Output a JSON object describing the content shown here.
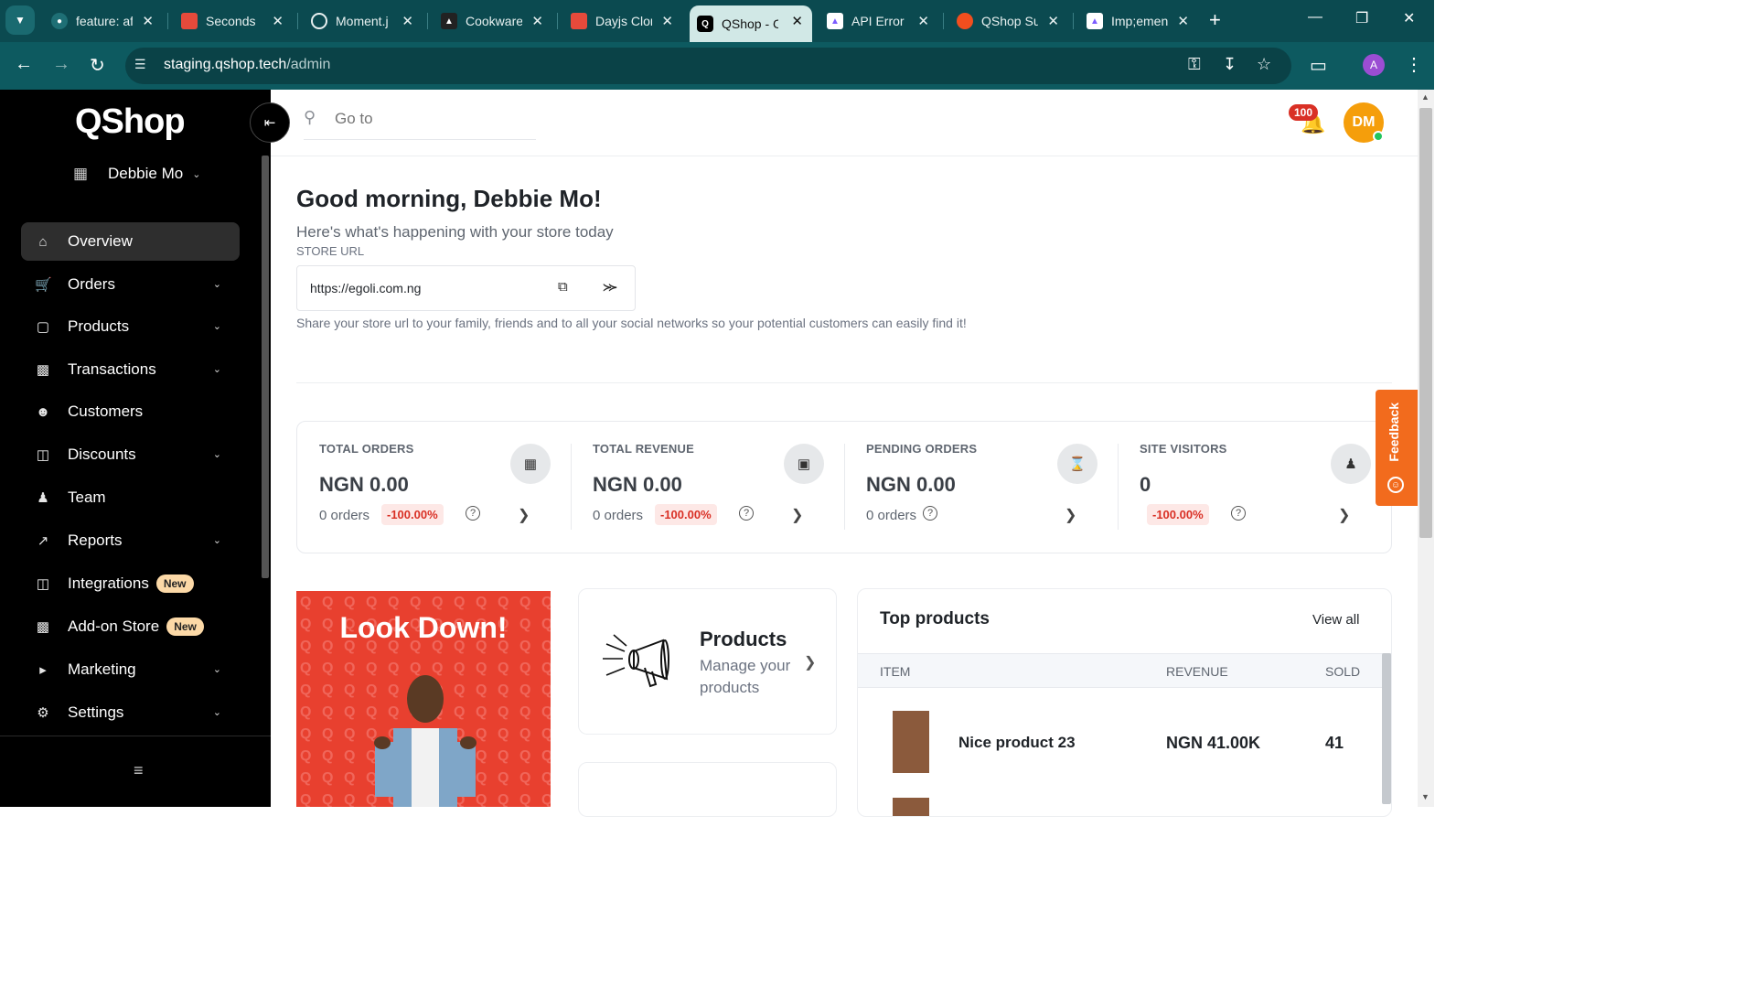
{
  "browser": {
    "tabs": [
      {
        "title": "feature: af",
        "favicon_color": "#1e6f75",
        "icon": "github-icon"
      },
      {
        "title": "Seconds",
        "favicon_color": "#e64a3b",
        "icon": "dayjs-icon"
      },
      {
        "title": "Moment.j",
        "favicon_color": "#1e6f75",
        "icon": "clock-icon"
      },
      {
        "title": "Cookware",
        "favicon_color": "#222222",
        "icon": "cookware-icon"
      },
      {
        "title": "Dayjs Clon",
        "favicon_color": "#e64a3b",
        "icon": "dayjs-icon"
      },
      {
        "title": "QShop - C",
        "favicon_color": "#000000",
        "icon": "qshop-icon",
        "active": true
      },
      {
        "title": "API Error",
        "favicon_color": "#ffffff",
        "icon": "clickup-icon"
      },
      {
        "title": "QShop Su",
        "favicon_color": "#f24e1e",
        "icon": "figma-icon"
      },
      {
        "title": "Imp;emen",
        "favicon_color": "#ffffff",
        "icon": "clickup-icon"
      }
    ],
    "url_host": "staging.qshop.tech",
    "url_path": "/admin",
    "profile_initial": "A"
  },
  "sidebar": {
    "logo": "QShop",
    "store_name": "Debbie Mo",
    "items": [
      {
        "label": "Overview",
        "icon": "home-icon",
        "active": true
      },
      {
        "label": "Orders",
        "icon": "cart-icon",
        "has_dropdown": true
      },
      {
        "label": "Products",
        "icon": "bag-icon",
        "has_dropdown": true
      },
      {
        "label": "Transactions",
        "icon": "cash-icon",
        "has_dropdown": true
      },
      {
        "label": "Customers",
        "icon": "customers-icon"
      },
      {
        "label": "Discounts",
        "icon": "gift-icon",
        "has_dropdown": true
      },
      {
        "label": "Team",
        "icon": "team-icon"
      },
      {
        "label": "Reports",
        "icon": "chart-icon",
        "has_dropdown": true
      },
      {
        "label": "Integrations",
        "icon": "integrations-icon",
        "badge": "New"
      },
      {
        "label": "Add-on Store",
        "icon": "puzzle-icon",
        "badge": "New"
      },
      {
        "label": "Marketing",
        "icon": "megaphone-icon",
        "has_dropdown": true
      },
      {
        "label": "Settings",
        "icon": "gear-icon",
        "has_dropdown": true
      }
    ]
  },
  "header": {
    "search_placeholder": "Go to",
    "notification_count": "100",
    "avatar_initials": "DM"
  },
  "main": {
    "greeting": "Good morning, Debbie Mo!",
    "subtitle": "Here's what's happening with your store today",
    "store_url_label": "STORE URL",
    "store_url": "https://egoli.com.ng",
    "share_note": "Share your store url to your family, friends and to all your social networks so your potential customers can easily find it!",
    "stats": [
      {
        "label": "TOTAL ORDERS",
        "value": "NGN 0.00",
        "orders": "0 orders",
        "change": "-100.00%",
        "icon": "store-icon"
      },
      {
        "label": "TOTAL REVENUE",
        "value": "NGN 0.00",
        "orders": "0 orders",
        "change": "-100.00%",
        "icon": "revenue-icon"
      },
      {
        "label": "PENDING ORDERS",
        "value": "NGN 0.00",
        "orders": "0 orders",
        "change": "",
        "icon": "hourglass-icon"
      },
      {
        "label": "SITE VISITORS",
        "value": "0",
        "orders": "",
        "change": "-100.00%",
        "icon": "visitors-icon"
      }
    ],
    "promo_title": "Look Down!",
    "products_card": {
      "title": "Products",
      "description": "Manage your products"
    },
    "top_products": {
      "title": "Top products",
      "view_all": "View all",
      "columns": [
        "ITEM",
        "REVENUE",
        "SOLD"
      ],
      "rows": [
        {
          "name": "Nice product 23",
          "revenue": "NGN 41.00K",
          "sold": "41"
        }
      ]
    },
    "feedback_label": "Feedback"
  },
  "colors": {
    "chrome_tabbar": "#0b4a50",
    "chrome_toolbar": "#0d5a60",
    "sidebar_bg": "#000000",
    "accent_orange": "#f26b1d",
    "avatar": "#f59e0b",
    "negative": "#d93025",
    "promo": "#e8402f"
  }
}
